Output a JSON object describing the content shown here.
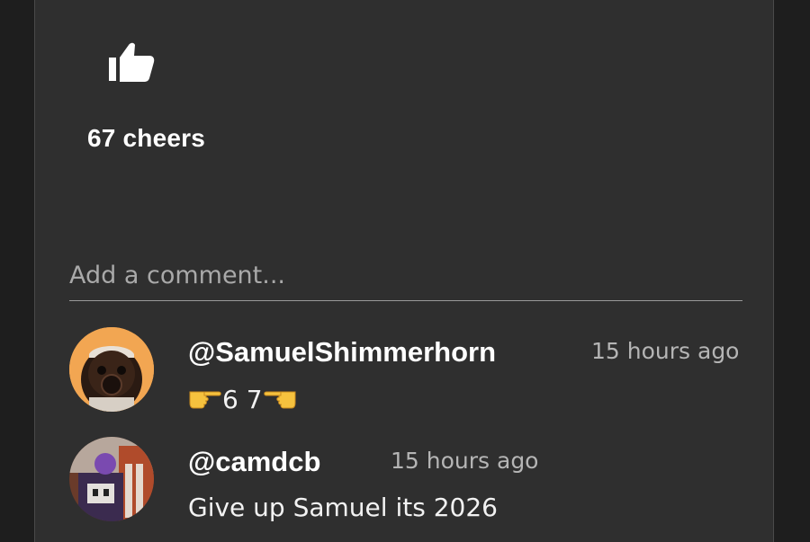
{
  "post": {
    "cheers_label": "67 cheers"
  },
  "comment_box": {
    "placeholder": "Add a comment..."
  },
  "comments": [
    {
      "handle": "@SamuelShimmerhorn",
      "time": "15 hours ago",
      "text_middle": "6 7",
      "leading_icon": "pointing-right-hand-icon",
      "trailing_icon": "pointing-left-hand-icon"
    },
    {
      "handle": "@camdcb",
      "time": "15 hours ago",
      "text": "Give up Samuel its 2026"
    }
  ],
  "colors": {
    "page_bg": "#1e1e1e",
    "card_bg": "#2f2f2f",
    "text_primary": "#ffffff",
    "text_secondary": "#b5b5b5",
    "avatar1_bg": "#f2a652"
  }
}
